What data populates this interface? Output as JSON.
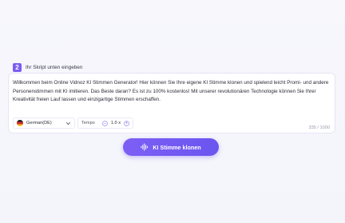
{
  "step": {
    "number": "2",
    "title": "Ihr Skript unten eingeben"
  },
  "editor": {
    "text": "Willkommen beim Online Vidnoz KI Stimmen Generator! Hier können Sie Ihre eigene KI Stimme klonen und spielend leicht Promi- und andere Personenstimmen mit KI imitieren. Das Beste daran? Es ist zu 100% kostenlos! Mit unserer revolutionären Technologie können Sie Ihrer Kreativität freien Lauf lassen und einzigartige Stimmen erschaffen.",
    "char_count": "335 / 1000"
  },
  "language": {
    "selected": "German(DE)",
    "flag_icon": "germany-flag-icon"
  },
  "tempo": {
    "label": "Tempo",
    "value": "1.0 x",
    "minus": "−",
    "plus": "+"
  },
  "action": {
    "label": "KI Stimme klonen"
  },
  "colors": {
    "accent": "#7a5cf0",
    "button": "#6f58f2"
  }
}
